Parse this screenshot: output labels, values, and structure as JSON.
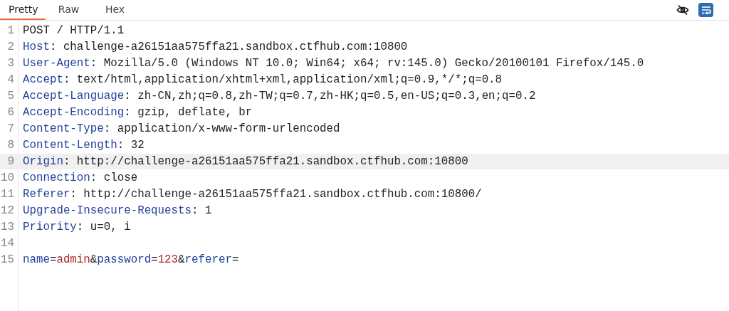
{
  "tabs": [
    {
      "label": "Pretty",
      "selected": true
    },
    {
      "label": "Raw",
      "selected": false
    },
    {
      "label": "Hex",
      "selected": false
    }
  ],
  "toolbar": {
    "wrap_on": true
  },
  "editor": {
    "lines": [
      {
        "number": "1",
        "selected": false,
        "segments": [
          {
            "kind": "plain",
            "text": "POST / HTTP/1.1"
          }
        ]
      },
      {
        "number": "2",
        "selected": false,
        "segments": [
          {
            "kind": "name",
            "text": "Host"
          },
          {
            "kind": "plain",
            "text": ": challenge-a26151aa575ffa21.sandbox.ctfhub.com:10800"
          }
        ]
      },
      {
        "number": "3",
        "selected": false,
        "segments": [
          {
            "kind": "name",
            "text": "User-Agent"
          },
          {
            "kind": "plain",
            "text": ": Mozilla/5.0 (Windows NT 10.0; Win64; x64; rv:145.0) Gecko/20100101 Firefox/145.0"
          }
        ]
      },
      {
        "number": "4",
        "selected": false,
        "segments": [
          {
            "kind": "name",
            "text": "Accept"
          },
          {
            "kind": "plain",
            "text": ": text/html,application/xhtml+xml,application/xml;q=0.9,*/*;q=0.8"
          }
        ]
      },
      {
        "number": "5",
        "selected": false,
        "segments": [
          {
            "kind": "name",
            "text": "Accept-Language"
          },
          {
            "kind": "plain",
            "text": ": zh-CN,zh;q=0.8,zh-TW;q=0.7,zh-HK;q=0.5,en-US;q=0.3,en;q=0.2"
          }
        ]
      },
      {
        "number": "6",
        "selected": false,
        "segments": [
          {
            "kind": "name",
            "text": "Accept-Encoding"
          },
          {
            "kind": "plain",
            "text": ": gzip, deflate, br"
          }
        ]
      },
      {
        "number": "7",
        "selected": false,
        "segments": [
          {
            "kind": "name",
            "text": "Content-Type"
          },
          {
            "kind": "plain",
            "text": ": application/x-www-form-urlencoded"
          }
        ]
      },
      {
        "number": "8",
        "selected": false,
        "segments": [
          {
            "kind": "name",
            "text": "Content-Length"
          },
          {
            "kind": "plain",
            "text": ": 32"
          }
        ]
      },
      {
        "number": "9",
        "selected": true,
        "segments": [
          {
            "kind": "name",
            "text": "Origin"
          },
          {
            "kind": "plain",
            "text": ": http://challenge-a26151aa575ffa21.sandbox.ctfhub.com:10800"
          }
        ]
      },
      {
        "number": "10",
        "selected": false,
        "segments": [
          {
            "kind": "name",
            "text": "Connection"
          },
          {
            "kind": "plain",
            "text": ": close"
          }
        ]
      },
      {
        "number": "11",
        "selected": false,
        "segments": [
          {
            "kind": "name",
            "text": "Referer"
          },
          {
            "kind": "plain",
            "text": ": http://challenge-a26151aa575ffa21.sandbox.ctfhub.com:10800/"
          }
        ]
      },
      {
        "number": "12",
        "selected": false,
        "segments": [
          {
            "kind": "name",
            "text": "Upgrade-Insecure-Requests"
          },
          {
            "kind": "plain",
            "text": ": 1"
          }
        ]
      },
      {
        "number": "13",
        "selected": false,
        "segments": [
          {
            "kind": "name",
            "text": "Priority"
          },
          {
            "kind": "plain",
            "text": ": u=0, i"
          }
        ]
      },
      {
        "number": "14",
        "selected": false
      },
      {
        "number": "15",
        "selected": false,
        "segments": [
          {
            "kind": "name",
            "text": "name"
          },
          {
            "kind": "plain",
            "text": "="
          },
          {
            "kind": "value",
            "text": "admin"
          },
          {
            "kind": "plain",
            "text": "&"
          },
          {
            "kind": "name",
            "text": "password"
          },
          {
            "kind": "plain",
            "text": "="
          },
          {
            "kind": "value",
            "text": "123"
          },
          {
            "kind": "plain",
            "text": "&"
          },
          {
            "kind": "name",
            "text": "referer"
          },
          {
            "kind": "plain",
            "text": "="
          }
        ]
      }
    ]
  }
}
